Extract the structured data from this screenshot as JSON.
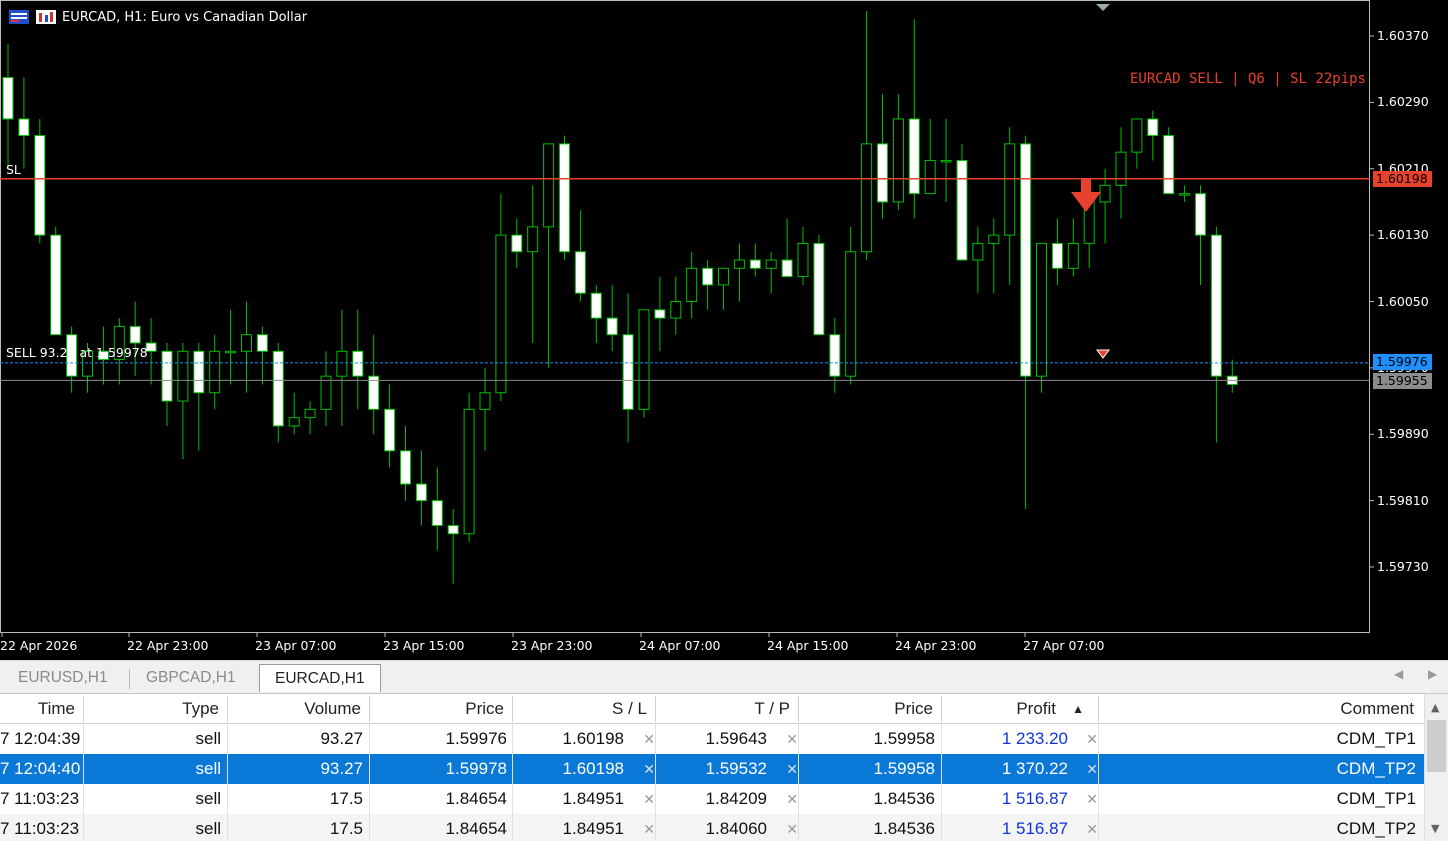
{
  "chart": {
    "title": "EURCAD, H1:  Euro vs Canadian Dollar",
    "signal_text": "EURCAD SELL | Q6 | SL 22pips",
    "sl_line_label": "SL",
    "entry_line_label": "SELL 93.27 at 1.59978",
    "sl_price": "1.60198",
    "entry_price": "1.59976",
    "bid_price": "1.59955",
    "y_ticks": [
      "1.60370",
      "1.60290",
      "1.60210",
      "1.60130",
      "1.60050",
      "1.59970",
      "1.59890",
      "1.59810",
      "1.59730"
    ],
    "x_ticks": [
      "22 Apr 2026",
      "22 Apr 23:00",
      "23 Apr 07:00",
      "23 Apr 15:00",
      "23 Apr 23:00",
      "24 Apr 07:00",
      "24 Apr 15:00",
      "24 Apr 23:00",
      "27 Apr 07:00"
    ],
    "colors": {
      "bull": "#000000",
      "bear": "#ffffff",
      "wick": "#00c000",
      "sl_line": "#e8412d",
      "entry_line": "#1e90ff",
      "bid_line": "#8c8c8c"
    },
    "candles": [
      [
        1.6032,
        1.6036,
        1.6021,
        1.6027
      ],
      [
        1.6027,
        1.6032,
        1.6021,
        1.6025
      ],
      [
        1.6025,
        1.6027,
        1.6012,
        1.6013
      ],
      [
        1.6013,
        1.6014,
        1.6001,
        1.6001
      ],
      [
        1.6001,
        1.6002,
        1.5994,
        1.5996
      ],
      [
        1.5996,
        1.6,
        1.5994,
        1.5999
      ],
      [
        1.5999,
        1.6002,
        1.5995,
        1.5998
      ],
      [
        1.5998,
        1.6003,
        1.5995,
        1.6002
      ],
      [
        1.6002,
        1.6005,
        1.5996,
        1.6
      ],
      [
        1.6,
        1.6003,
        1.5995,
        1.5999
      ],
      [
        1.5999,
        1.6,
        1.599,
        1.5993
      ],
      [
        1.5993,
        1.6,
        1.5986,
        1.5999
      ],
      [
        1.5999,
        1.6,
        1.5987,
        1.5994
      ],
      [
        1.5994,
        1.6001,
        1.5992,
        1.5999
      ],
      [
        1.5999,
        1.6004,
        1.5995,
        1.5999
      ],
      [
        1.5999,
        1.6005,
        1.5994,
        1.6001
      ],
      [
        1.6001,
        1.6002,
        1.5995,
        1.5999
      ],
      [
        1.5999,
        1.6,
        1.5988,
        1.599
      ],
      [
        1.599,
        1.5994,
        1.5989,
        1.5991
      ],
      [
        1.5991,
        1.5993,
        1.5989,
        1.5992
      ],
      [
        1.5992,
        1.5999,
        1.599,
        1.5996
      ],
      [
        1.5996,
        1.6004,
        1.599,
        1.5999
      ],
      [
        1.5999,
        1.6004,
        1.5992,
        1.5996
      ],
      [
        1.5996,
        1.6001,
        1.5989,
        1.5992
      ],
      [
        1.5992,
        1.5995,
        1.5985,
        1.5987
      ],
      [
        1.5987,
        1.599,
        1.5981,
        1.5983
      ],
      [
        1.5983,
        1.5987,
        1.5978,
        1.5981
      ],
      [
        1.5981,
        1.5985,
        1.5975,
        1.5978
      ],
      [
        1.5978,
        1.598,
        1.5971,
        1.5977
      ],
      [
        1.5977,
        1.5994,
        1.5976,
        1.5992
      ],
      [
        1.5992,
        1.5997,
        1.5987,
        1.5994
      ],
      [
        1.5994,
        1.6018,
        1.5993,
        1.6013
      ],
      [
        1.6013,
        1.6015,
        1.6009,
        1.6011
      ],
      [
        1.6011,
        1.6019,
        1.6,
        1.6014
      ],
      [
        1.6014,
        1.6024,
        1.5997,
        1.6024
      ],
      [
        1.6024,
        1.6025,
        1.601,
        1.6011
      ],
      [
        1.6011,
        1.6016,
        1.6005,
        1.6006
      ],
      [
        1.6006,
        1.6007,
        1.6,
        1.6003
      ],
      [
        1.6003,
        1.6007,
        1.5999,
        1.6001
      ],
      [
        1.6001,
        1.6006,
        1.5988,
        1.5992
      ],
      [
        1.5992,
        1.6004,
        1.5991,
        1.6004
      ],
      [
        1.6004,
        1.6008,
        1.5999,
        1.6003
      ],
      [
        1.6003,
        1.6008,
        1.6001,
        1.6005
      ],
      [
        1.6005,
        1.6011,
        1.6003,
        1.6009
      ],
      [
        1.6009,
        1.601,
        1.6004,
        1.6007
      ],
      [
        1.6007,
        1.6009,
        1.6004,
        1.6009
      ],
      [
        1.6009,
        1.6012,
        1.6005,
        1.601
      ],
      [
        1.601,
        1.6012,
        1.6008,
        1.6009
      ],
      [
        1.6009,
        1.6011,
        1.6006,
        1.601
      ],
      [
        1.601,
        1.6015,
        1.6008,
        1.6008
      ],
      [
        1.6008,
        1.6014,
        1.6007,
        1.6012
      ],
      [
        1.6012,
        1.6013,
        1.6001,
        1.6001
      ],
      [
        1.6001,
        1.6003,
        1.5994,
        1.5996
      ],
      [
        1.5996,
        1.6014,
        1.5995,
        1.6011
      ],
      [
        1.6011,
        1.604,
        1.601,
        1.6024
      ],
      [
        1.6024,
        1.603,
        1.6015,
        1.6017
      ],
      [
        1.6017,
        1.603,
        1.6016,
        1.6027
      ],
      [
        1.6027,
        1.6039,
        1.6015,
        1.6018
      ],
      [
        1.6018,
        1.6027,
        1.6018,
        1.6022
      ],
      [
        1.6022,
        1.6027,
        1.6017,
        1.6022
      ],
      [
        1.6022,
        1.6024,
        1.601,
        1.601
      ],
      [
        1.601,
        1.6014,
        1.6006,
        1.6012
      ],
      [
        1.6012,
        1.6015,
        1.6006,
        1.6013
      ],
      [
        1.6013,
        1.6026,
        1.6007,
        1.6024
      ],
      [
        1.6024,
        1.6025,
        1.598,
        1.5996
      ],
      [
        1.5996,
        1.6012,
        1.5994,
        1.6012
      ],
      [
        1.6012,
        1.6015,
        1.6007,
        1.6009
      ],
      [
        1.6009,
        1.6015,
        1.6008,
        1.6012
      ],
      [
        1.6012,
        1.6017,
        1.6009,
        1.6017
      ],
      [
        1.6017,
        1.6021,
        1.6012,
        1.6019
      ],
      [
        1.6019,
        1.6026,
        1.6015,
        1.6023
      ],
      [
        1.6023,
        1.6027,
        1.6021,
        1.6027
      ],
      [
        1.6027,
        1.6028,
        1.6022,
        1.6025
      ],
      [
        1.6025,
        1.6026,
        1.6018,
        1.6018
      ],
      [
        1.6018,
        1.6019,
        1.6017,
        1.6018
      ],
      [
        1.6018,
        1.6019,
        1.6007,
        1.6013
      ],
      [
        1.6013,
        1.6014,
        1.5988,
        1.5996
      ],
      [
        1.5996,
        1.5998,
        1.5994,
        1.5995
      ]
    ]
  },
  "tabs": [
    "EURUSD,H1",
    "GBPCAD,H1",
    "EURCAD,H1"
  ],
  "table": {
    "headers": [
      "Time",
      "Type",
      "Volume",
      "Price",
      "S / L",
      "T / P",
      "Price",
      "Profit",
      "Comment"
    ],
    "rows": [
      [
        "7 12:04:39",
        "sell",
        "93.27",
        "1.59976",
        "1.60198",
        "1.59643",
        "1.59958",
        "1 233.20",
        "CDM_TP1"
      ],
      [
        "7 12:04:40",
        "sell",
        "93.27",
        "1.59978",
        "1.60198",
        "1.59532",
        "1.59958",
        "1 370.22",
        "CDM_TP2"
      ],
      [
        "7 11:03:23",
        "sell",
        "17.5",
        "1.84654",
        "1.84951",
        "1.84209",
        "1.84536",
        "1 516.87",
        "CDM_TP1"
      ],
      [
        "7 11:03:23",
        "sell",
        "17.5",
        "1.84654",
        "1.84951",
        "1.84060",
        "1.84536",
        "1 516.87",
        "CDM_TP2"
      ]
    ]
  }
}
